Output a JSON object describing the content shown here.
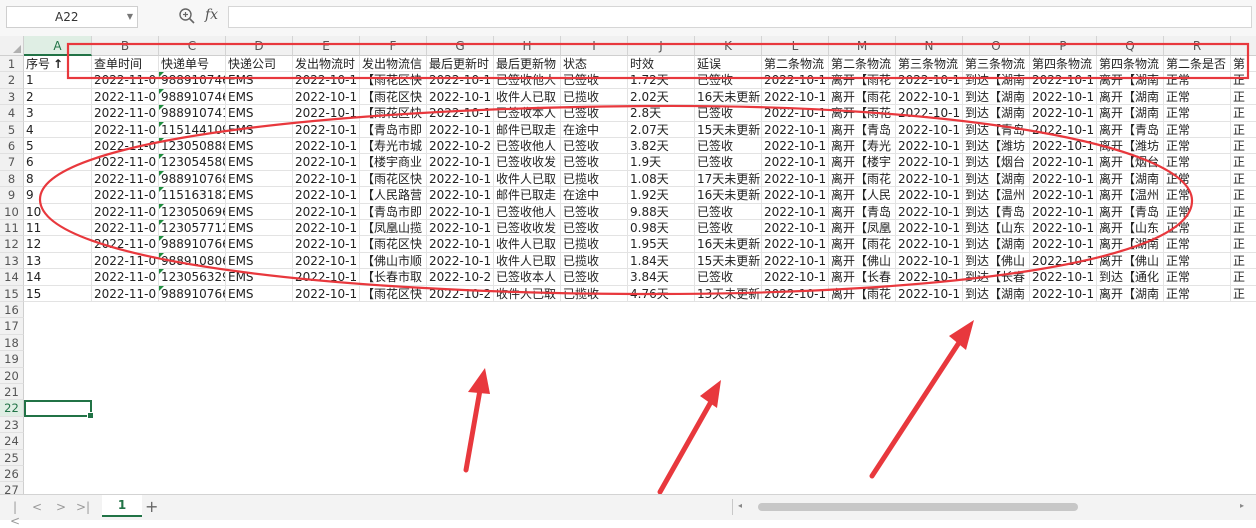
{
  "formula_bar": {
    "name_box": "A22",
    "zoom_icon": "magnifier-zoom-icon",
    "fx_label": "fx",
    "formula_value": ""
  },
  "colors": {
    "accent": "#217346",
    "annotation": "#e8383d",
    "flag": "#1e8e3e"
  },
  "sheet": {
    "selected_cell": "A22",
    "selected_column": "A",
    "selected_row": 22,
    "column_letters": [
      "A",
      "B",
      "C",
      "D",
      "E",
      "F",
      "G",
      "H",
      "I",
      "J",
      "K",
      "L",
      "M",
      "N",
      "O",
      "P",
      "Q",
      "R",
      "S"
    ],
    "row_numbers": [
      1,
      2,
      3,
      4,
      5,
      6,
      7,
      8,
      9,
      10,
      11,
      12,
      13,
      14,
      15,
      16,
      17,
      18,
      19,
      20,
      21,
      22,
      23,
      24,
      25,
      26,
      27
    ],
    "header_row": [
      "序号",
      "查单时间",
      "快递单号",
      "快递公司",
      "发出物流时",
      "发出物流信",
      "最后更新时",
      "最后更新物",
      "状态",
      "时效",
      "延误",
      "第二条物流",
      "第二条物流",
      "第三条物流",
      "第三条物流",
      "第四条物流",
      "第四条物流",
      "第二条是否",
      "第"
    ],
    "sort_indicator": "↑",
    "rows": [
      [
        "1",
        "2022-11-0",
        "988910746",
        "EMS",
        "2022-10-1",
        "【雨花区快",
        "2022-10-1",
        "已签收他人",
        "已签收",
        "1.72天",
        "已签收",
        "2022-10-1",
        "离开【雨花",
        "2022-10-1",
        "到达【湖南",
        "2022-10-1",
        "离开【湖南",
        "正常",
        "正"
      ],
      [
        "2",
        "2022-11-0",
        "988910746",
        "EMS",
        "2022-10-1",
        "【雨花区快",
        "2022-10-1",
        "收件人已取",
        "已揽收",
        "2.02天",
        "16天未更新",
        "2022-10-1",
        "离开【雨花",
        "2022-10-1",
        "到达【湖南",
        "2022-10-1",
        "离开【湖南",
        "正常",
        "正"
      ],
      [
        "3",
        "2022-11-0",
        "988910741",
        "EMS",
        "2022-10-1",
        "【雨花区快",
        "2022-10-1",
        "已签收本人",
        "已签收",
        "2.8天",
        "已签收",
        "2022-10-1",
        "离开【雨花",
        "2022-10-1",
        "到达【湖南",
        "2022-10-1",
        "离开【湖南",
        "正常",
        "正"
      ],
      [
        "4",
        "2022-11-0",
        "115144109",
        "EMS",
        "2022-10-1",
        "【青岛市即",
        "2022-10-1",
        "邮件已取走",
        "在途中",
        "2.07天",
        "15天未更新",
        "2022-10-1",
        "离开【青岛",
        "2022-10-1",
        "到达【青岛",
        "2022-10-1",
        "离开【青岛",
        "正常",
        "正"
      ],
      [
        "5",
        "2022-11-0",
        "123050888",
        "EMS",
        "2022-10-1",
        "【寿光市城",
        "2022-10-2",
        "已签收他人",
        "已签收",
        "3.82天",
        "已签收",
        "2022-10-1",
        "离开【寿光",
        "2022-10-1",
        "到达【潍坊",
        "2022-10-1",
        "离开【潍坊",
        "正常",
        "正"
      ],
      [
        "6",
        "2022-11-0",
        "123054580",
        "EMS",
        "2022-10-1",
        "【楼宇商业",
        "2022-10-1",
        "已签收收发",
        "已签收",
        "1.9天",
        "已签收",
        "2022-10-1",
        "离开【楼宇",
        "2022-10-1",
        "到达【烟台",
        "2022-10-1",
        "离开【烟台",
        "正常",
        "正"
      ],
      [
        "8",
        "2022-11-0",
        "988910768",
        "EMS",
        "2022-10-1",
        "【雨花区快",
        "2022-10-1",
        "收件人已取",
        "已揽收",
        "1.08天",
        "17天未更新",
        "2022-10-1",
        "离开【雨花",
        "2022-10-1",
        "到达【湖南",
        "2022-10-1",
        "离开【湖南",
        "正常",
        "正"
      ],
      [
        "9",
        "2022-11-0",
        "115163182",
        "EMS",
        "2022-10-1",
        "【人民路营",
        "2022-10-1",
        "邮件已取走",
        "在途中",
        "1.92天",
        "16天未更新",
        "2022-10-1",
        "离开【人民",
        "2022-10-1",
        "到达【温州",
        "2022-10-1",
        "离开【温州",
        "正常",
        "正"
      ],
      [
        "10",
        "2022-11-0",
        "123050696",
        "EMS",
        "2022-10-1",
        "【青岛市即",
        "2022-10-1",
        "已签收他人",
        "已签收",
        "9.88天",
        "已签收",
        "2022-10-1",
        "离开【青岛",
        "2022-10-1",
        "到达【青岛",
        "2022-10-1",
        "离开【青岛",
        "正常",
        "正"
      ],
      [
        "11",
        "2022-11-0",
        "123057712",
        "EMS",
        "2022-10-1",
        "【凤凰山揽",
        "2022-10-1",
        "已签收收发",
        "已签收",
        "0.98天",
        "已签收",
        "2022-10-1",
        "离开【凤凰",
        "2022-10-1",
        "到达【山东",
        "2022-10-1",
        "离开【山东",
        "正常",
        "正"
      ],
      [
        "12",
        "2022-11-0",
        "988910766",
        "EMS",
        "2022-10-1",
        "【雨花区快",
        "2022-10-1",
        "收件人已取",
        "已揽收",
        "1.95天",
        "16天未更新",
        "2022-10-1",
        "离开【雨花",
        "2022-10-1",
        "到达【湖南",
        "2022-10-1",
        "离开【湖南",
        "正常",
        "正"
      ],
      [
        "13",
        "2022-11-0",
        "988910806",
        "EMS",
        "2022-10-1",
        "【佛山市顺",
        "2022-10-1",
        "收件人已取",
        "已揽收",
        "1.84天",
        "15天未更新",
        "2022-10-1",
        "离开【佛山",
        "2022-10-1",
        "到达【佛山",
        "2022-10-1",
        "离开【佛山",
        "正常",
        "正"
      ],
      [
        "14",
        "2022-11-0",
        "123056329",
        "EMS",
        "2022-10-1",
        "【长春市取",
        "2022-10-2",
        "已签收本人",
        "已签收",
        "3.84天",
        "已签收",
        "2022-10-1",
        "离开【长春",
        "2022-10-1",
        "到达【长春",
        "2022-10-1",
        "到达【通化",
        "正常",
        "正"
      ],
      [
        "15",
        "2022-11-0",
        "988910766",
        "EMS",
        "2022-10-1",
        "【雨花区快",
        "2022-10-2",
        "收件人已取",
        "已揽收",
        "4.76天",
        "13天未更新",
        "2022-10-1",
        "离开【雨花",
        "2022-10-1",
        "到达【湖南",
        "2022-10-1",
        "离开【湖南",
        "正常",
        "正"
      ]
    ],
    "flagged_column": "C"
  },
  "tabs": {
    "nav_first": "|<",
    "nav_prev": "<",
    "nav_next": ">",
    "nav_last": ">|",
    "sheet_name": "1",
    "add_sheet": "+"
  },
  "scrollbar": {
    "left_arrow": "◂",
    "right_arrow": "▸"
  }
}
